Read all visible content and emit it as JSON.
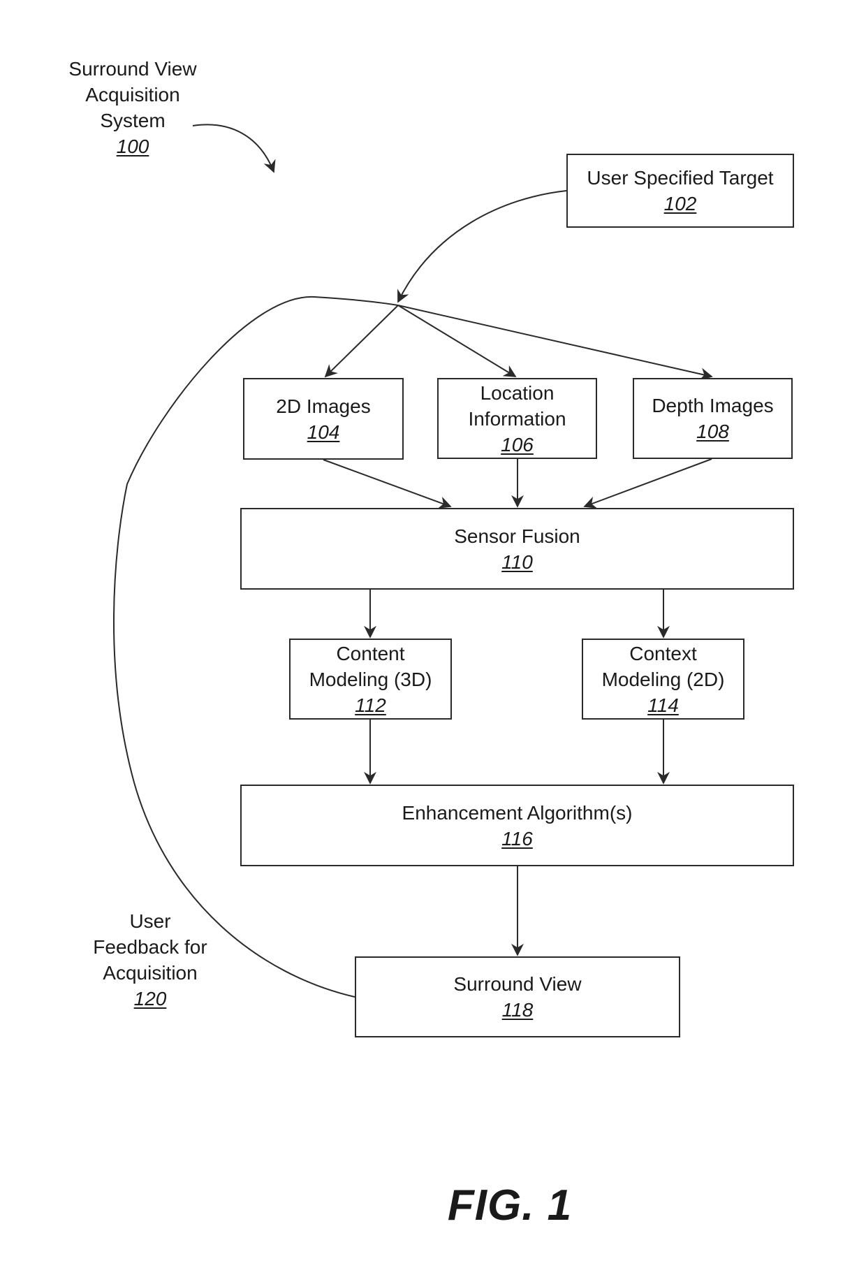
{
  "system_label": {
    "lines": [
      "Surround View",
      "Acquisition",
      "System"
    ],
    "ref": "100"
  },
  "feedback_label": {
    "lines": [
      "User",
      "Feedback for",
      "Acquisition"
    ],
    "ref": "120"
  },
  "nodes": {
    "target": {
      "lines": [
        "User Specified Target"
      ],
      "ref": "102"
    },
    "images2d": {
      "lines": [
        "2D Images"
      ],
      "ref": "104"
    },
    "location": {
      "lines": [
        "Location",
        "Information"
      ],
      "ref": "106"
    },
    "depth": {
      "lines": [
        "Depth Images"
      ],
      "ref": "108"
    },
    "fusion": {
      "lines": [
        "Sensor Fusion"
      ],
      "ref": "110"
    },
    "content": {
      "lines": [
        "Content",
        "Modeling (3D)"
      ],
      "ref": "112"
    },
    "context": {
      "lines": [
        "Context",
        "Modeling (2D)"
      ],
      "ref": "114"
    },
    "enhancement": {
      "lines": [
        "Enhancement Algorithm(s)"
      ],
      "ref": "116"
    },
    "surround": {
      "lines": [
        "Surround View"
      ],
      "ref": "118"
    }
  },
  "edges": [
    {
      "from": "target",
      "to": "images2d"
    },
    {
      "from": "target",
      "to": "location"
    },
    {
      "from": "target",
      "to": "depth"
    },
    {
      "from": "images2d",
      "to": "fusion"
    },
    {
      "from": "location",
      "to": "fusion"
    },
    {
      "from": "depth",
      "to": "fusion"
    },
    {
      "from": "fusion",
      "to": "content"
    },
    {
      "from": "fusion",
      "to": "context"
    },
    {
      "from": "content",
      "to": "enhancement"
    },
    {
      "from": "context",
      "to": "enhancement"
    },
    {
      "from": "enhancement",
      "to": "surround"
    },
    {
      "from": "surround",
      "to": "images2d",
      "label": "feedback"
    }
  ],
  "figure_caption": "FIG. 1",
  "colors": {
    "line": "#2a2a2a",
    "text": "#1a1a1a",
    "background": "#ffffff"
  }
}
